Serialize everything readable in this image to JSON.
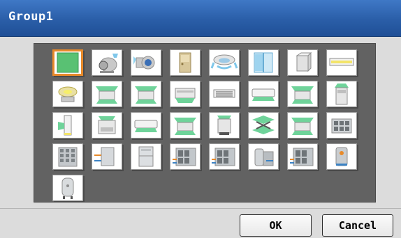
{
  "window": {
    "title": "Group1"
  },
  "icons": [
    {
      "name": "icon-green-square",
      "kind": "green",
      "selected": true
    },
    {
      "name": "icon-motor",
      "kind": "motor"
    },
    {
      "name": "icon-fan",
      "kind": "fan"
    },
    {
      "name": "icon-door",
      "kind": "door"
    },
    {
      "name": "icon-ceiling-round",
      "kind": "round"
    },
    {
      "name": "icon-window",
      "kind": "window"
    },
    {
      "name": "icon-box-unit",
      "kind": "box"
    },
    {
      "name": "icon-ceiling-panel",
      "kind": "panel"
    },
    {
      "name": "icon-ceiling-round-yellow",
      "kind": "roundy"
    },
    {
      "name": "icon-cassette-1",
      "kind": "cassette"
    },
    {
      "name": "icon-cassette-2",
      "kind": "cassette"
    },
    {
      "name": "icon-ceiling-suspended",
      "kind": "suspended"
    },
    {
      "name": "icon-wall-vent",
      "kind": "vent"
    },
    {
      "name": "icon-wall-mounted",
      "kind": "wall"
    },
    {
      "name": "icon-cassette-3",
      "kind": "cassette"
    },
    {
      "name": "icon-floor-unit",
      "kind": "floorup"
    },
    {
      "name": "icon-tower-unit",
      "kind": "tower"
    },
    {
      "name": "icon-floor-console",
      "kind": "console"
    },
    {
      "name": "icon-wall-split",
      "kind": "wall"
    },
    {
      "name": "icon-cassette-4",
      "kind": "cassette"
    },
    {
      "name": "icon-floor-standing",
      "kind": "floordown"
    },
    {
      "name": "icon-heat-exchanger",
      "kind": "exchanger"
    },
    {
      "name": "icon-cassette-5",
      "kind": "cassette"
    },
    {
      "name": "icon-outdoor-unit-1",
      "kind": "outdoor"
    },
    {
      "name": "icon-outdoor-unit-2",
      "kind": "outdoorgrid"
    },
    {
      "name": "icon-pipe-unit",
      "kind": "pipeunit"
    },
    {
      "name": "icon-cabinet",
      "kind": "cabinet"
    },
    {
      "name": "icon-chiller-1",
      "kind": "chiller"
    },
    {
      "name": "icon-chiller-2",
      "kind": "chiller"
    },
    {
      "name": "icon-tank-unit",
      "kind": "tankunit"
    },
    {
      "name": "icon-chiller-3",
      "kind": "chiller"
    },
    {
      "name": "icon-boiler",
      "kind": "boiler"
    },
    {
      "name": "icon-water-tank",
      "kind": "tank"
    }
  ],
  "buttons": {
    "ok": "OK",
    "cancel": "Cancel"
  }
}
